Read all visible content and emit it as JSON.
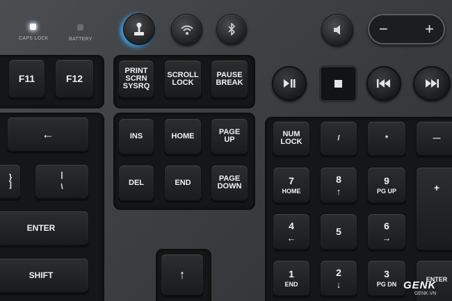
{
  "indicators": {
    "caps_lock": "CAPS LOCK",
    "battery": "BATTERY"
  },
  "top_buttons": [
    "game-mode-icon",
    "wifi-icon",
    "bluetooth-icon",
    "mute-icon"
  ],
  "volume": {
    "minus": "−",
    "plus": "+"
  },
  "fkeys": {
    "f11": "F11",
    "f12": "F12"
  },
  "system_keys": {
    "print": "PRINT\nSCRN\nSYSRQ",
    "scroll": "SCROLL\nLOCK",
    "pause": "PAUSE\nBREAK"
  },
  "media_icons": [
    "play-pause-icon",
    "stop-icon",
    "previous-icon",
    "next-icon"
  ],
  "nav_keys": {
    "ins": "INS",
    "home": "HOME",
    "page_up": "PAGE\nUP",
    "del": "DEL",
    "end": "END",
    "page_down": "PAGE\nDOWN"
  },
  "main_keys": {
    "backspace_arrow": "←",
    "brace": "}",
    "bracket": "]",
    "pipe": "|",
    "backslash": "\\",
    "enter": "ENTER",
    "shift": "SHIFT",
    "up_arrow": "↑"
  },
  "numpad": {
    "num_lock": "NUM\nLOCK",
    "slash": "/",
    "star": "*",
    "minus": "—",
    "plus": "+",
    "n7": "7",
    "n7_sub": "HOME",
    "n8": "8",
    "n8_sub": "↑",
    "n9": "9",
    "n9_sub": "PG UP",
    "n4": "4",
    "n4_sub": "←",
    "n5": "5",
    "n6": "6",
    "n6_sub": "→",
    "n1": "1",
    "n1_sub": "END",
    "n2": "2",
    "n2_sub": "↓",
    "n3": "3",
    "n3_sub": "PG DN",
    "enter": "ENTER"
  },
  "watermark": {
    "brand": "GENK",
    "site": "GENK.VN"
  },
  "colors": {
    "led_on": "#f4f8ff",
    "glow": "#3caaff",
    "key": "#222325"
  }
}
